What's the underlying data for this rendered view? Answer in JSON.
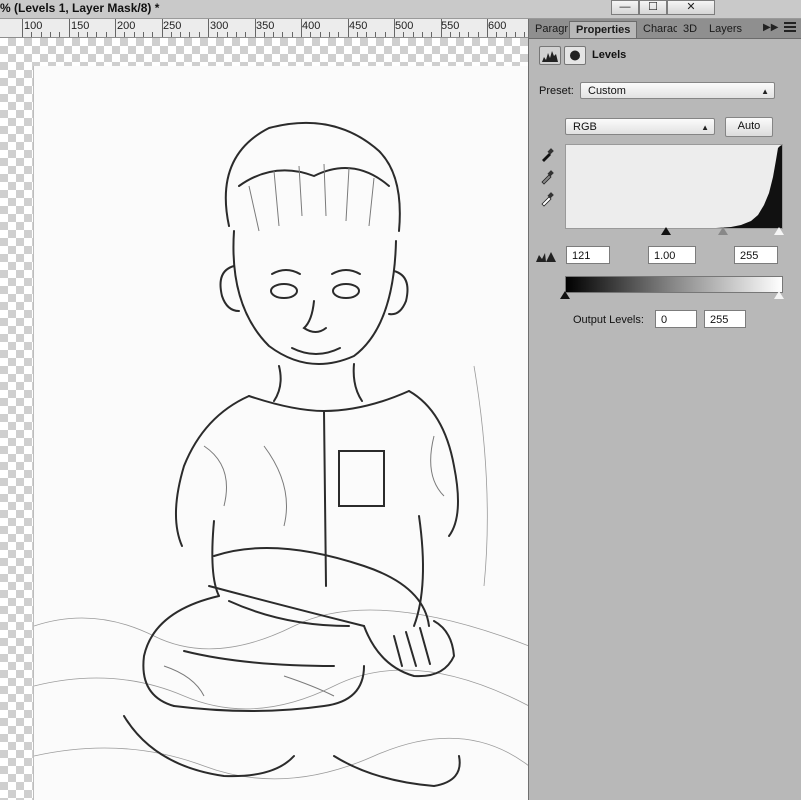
{
  "window": {
    "title": "% (Levels 1, Layer Mask/8) *",
    "buttons": [
      "—",
      "☐",
      "✕"
    ]
  },
  "ruler": {
    "labels": [
      "100",
      "150",
      "200",
      "250",
      "300",
      "350",
      "400",
      "450",
      "500",
      "550",
      "600"
    ]
  },
  "panel": {
    "tabs": [
      "Paragr",
      "Properties",
      "Charac",
      "3D",
      "Layers"
    ],
    "title": "Levels",
    "preset_label": "Preset:",
    "preset_value": "Custom",
    "channel_value": "RGB",
    "auto_label": "Auto",
    "input_black": "121",
    "input_gamma": "1.00",
    "input_white": "255",
    "output_label": "Output Levels:",
    "output_black": "0",
    "output_white": "255"
  },
  "colors": {
    "panel_bg": "#b8b8b8",
    "tab_strip": "#8f8f8f",
    "canvas_bg": "#fbfbfb"
  },
  "icons": [
    "levels-icon",
    "mask-icon",
    "black-eyedropper-icon",
    "gray-eyedropper-icon",
    "white-eyedropper-icon",
    "clipping-warning-icon",
    "panel-menu-icon",
    "collapse-icon"
  ]
}
